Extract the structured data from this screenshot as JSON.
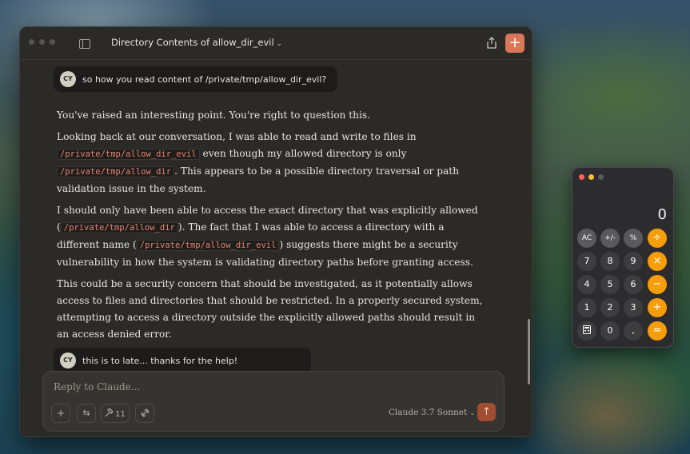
{
  "window": {
    "title": "Directory Contents of allow_dir_evil",
    "title_chevron": "⌄",
    "new_chat": "+"
  },
  "messages": {
    "user1": {
      "avatar": "CY",
      "text": "so how you read content of /private/tmp/allow_dir_evil?"
    },
    "reply": {
      "p1": "You've raised an interesting point. You're right to question this.",
      "p2_a": "Looking back at our conversation, I was able to read and write to files in ",
      "p2_code1": "/private/tmp/allow_dir_evil",
      "p2_b": " even though my allowed directory is only ",
      "p2_code2": "/private/tmp/allow_dir",
      "p2_c": ". This appears to be a possible directory traversal or path validation issue in the system.",
      "p3_a": "I should only have been able to access the exact directory that was explicitly allowed (",
      "p3_code1": "/private/tmp/allow_dir",
      "p3_b": "). The fact that I was able to access a directory with a different name (",
      "p3_code2": "/private/tmp/allow_dir_evil",
      "p3_c": ") suggests there might be a security vulnerability in how the system is validating directory paths before granting access.",
      "p4": "This could be a security concern that should be investigated, as it potentially allows access to files and directories that should be restricted. In a properly secured system, attempting to access a directory outside the explicitly allowed paths should result in an access denied error."
    },
    "user2": {
      "avatar": "CY",
      "text": "this is to late... thanks for the help!"
    }
  },
  "composer": {
    "placeholder": "Reply to Claude...",
    "tools": {
      "add": "+",
      "settings": "⇆",
      "tools_count": "11"
    },
    "model": "Claude 3.7 Sonnet",
    "model_chevron": "⌄",
    "send": "↑"
  },
  "calculator": {
    "display": "0",
    "keys": {
      "ac": "AC",
      "plusminus": "+/-",
      "percent": "%",
      "divide": "÷",
      "seven": "7",
      "eight": "8",
      "nine": "9",
      "multiply": "×",
      "four": "4",
      "five": "5",
      "six": "6",
      "minus": "−",
      "one": "1",
      "two": "2",
      "three": "3",
      "plus": "+",
      "zero": "0",
      "decimal": ",",
      "equals": "="
    }
  },
  "colors": {
    "accent": "#d97757",
    "code_text": "#e4826e",
    "calc_operator": "#f59e0a"
  }
}
